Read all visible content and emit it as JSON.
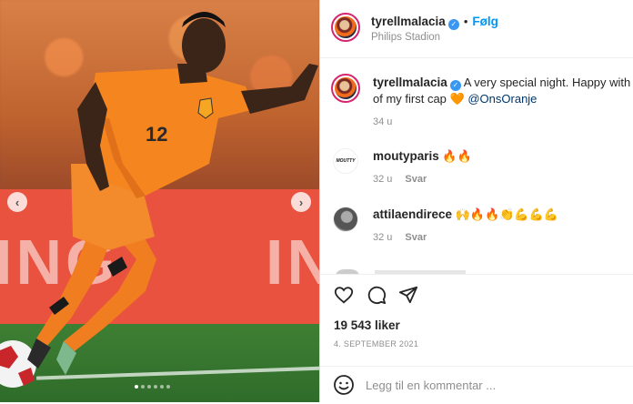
{
  "post": {
    "username": "tyrellmalacia",
    "follow_label": "Følg",
    "separator": "•",
    "location": "Philips Stadion",
    "photo": {
      "jersey_number": "12",
      "board_text_left": "ING",
      "board_text_right": "IN",
      "carousel_count": 6,
      "carousel_active": 0
    }
  },
  "caption": {
    "username": "tyrellmalacia",
    "text": "A very special night. Happy with the w",
    "text_line2": "of my first cap",
    "heart": "🧡",
    "mention": "@OnsOranje",
    "age": "34 u"
  },
  "comments": [
    {
      "username": "moutyparis",
      "text": "🔥🔥",
      "age": "32 u",
      "reply": "Svar",
      "avatar_text": "MOUTTY"
    },
    {
      "username": "attilaendirece",
      "text": "🙌🔥🔥👏💪💪💪",
      "age": "32 u",
      "reply": "Svar"
    }
  ],
  "actions": {
    "icons": [
      "heart-icon",
      "comment-icon",
      "share-icon"
    ]
  },
  "likes_text": "19 543 liker",
  "date_text": "4. SEPTEMBER 2021",
  "add_comment_placeholder": "Legg til en kommentar ..."
}
